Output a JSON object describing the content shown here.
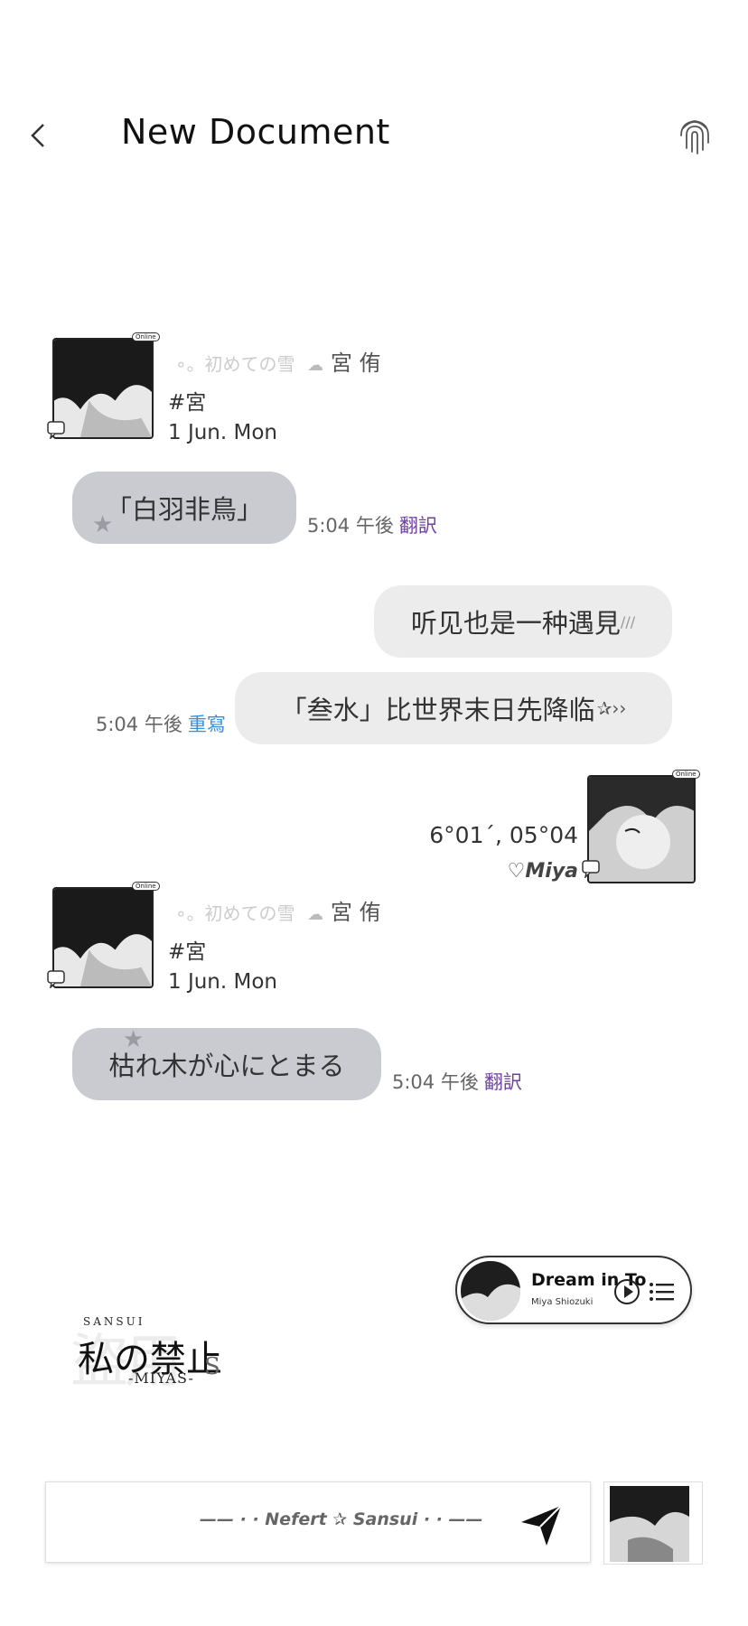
{
  "header": {
    "title": "New Document"
  },
  "posts": [
    {
      "online": "Online",
      "faint_text": "∘。初めての雪",
      "name": "宮 侑",
      "tag": "#宮",
      "date": "1 Jun. Mon",
      "message": "「白羽非鳥」",
      "time": "5:04 午後",
      "action": "翻訳"
    },
    {
      "online": "Online",
      "faint_text": "∘。初めての雪",
      "name": "宮 侑",
      "tag": "#宮",
      "date": "1 Jun. Mon",
      "message": "枯れ木が心にとまる",
      "time": "5:04 午後",
      "action": "翻訳"
    }
  ],
  "outgoing": {
    "message_1": "听见也是一种遇見",
    "message_2": "「叁水」比世界末日先降临",
    "time": "5:04 午後",
    "action": "重寫"
  },
  "profile_card": {
    "online": "Online",
    "coords": "6°01´, 05°04",
    "signature": "♡Miya"
  },
  "player": {
    "title": "Dream in To",
    "artist": "Miya Shiozuki"
  },
  "logo": {
    "ghost": "盜用",
    "small": "SANSUI",
    "main": "私の禁止",
    "sub": "-MIYAS-",
    "s": "S"
  },
  "composer": {
    "text": "—— · · Nefert ✰ Sansui · · ——"
  }
}
